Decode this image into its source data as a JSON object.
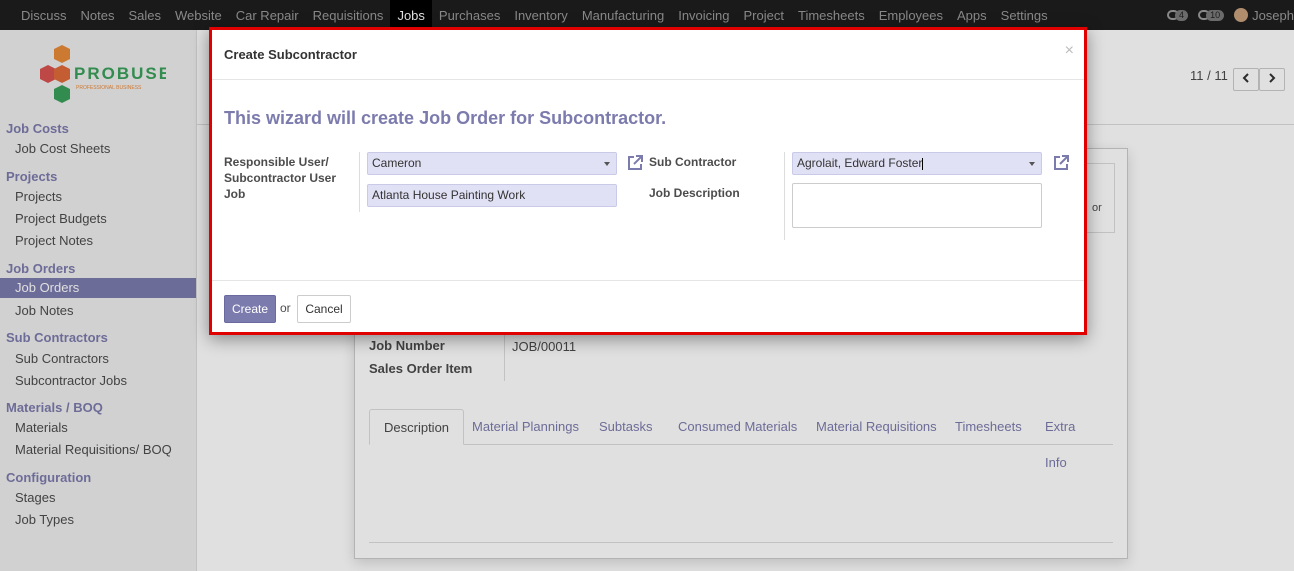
{
  "menu": [
    "Discuss",
    "Notes",
    "Sales",
    "Website",
    "Car Repair",
    "Requisitions",
    "Jobs",
    "Purchases",
    "Inventory",
    "Manufacturing",
    "Invoicing",
    "Project",
    "Timesheets",
    "Employees",
    "Apps",
    "Settings"
  ],
  "menu_active": "Jobs",
  "topbar": {
    "chat_count": "4",
    "activity_count": "10",
    "user": "Joseph"
  },
  "logo": {
    "name": "PROBUSE",
    "tagline": "PROFESSIONAL BUSINESS"
  },
  "sidebar": {
    "sections": [
      {
        "title": "Job Costs",
        "items": [
          "Job Cost Sheets"
        ]
      },
      {
        "title": "Projects",
        "items": [
          "Projects",
          "Project Budgets",
          "Project Notes"
        ]
      },
      {
        "title": "Job Orders",
        "items": [
          "Job Orders",
          "Job Notes"
        ]
      },
      {
        "title": "Sub Contractors",
        "items": [
          "Sub Contractors",
          "Subcontractor Jobs"
        ]
      },
      {
        "title": "Materials / BOQ",
        "items": [
          "Materials",
          "Material Requisitions/ BOQ"
        ]
      },
      {
        "title": "Configuration",
        "items": [
          "Stages",
          "Job Types"
        ]
      }
    ],
    "active_item": "Job Orders"
  },
  "pager": {
    "text": "11 / 11"
  },
  "background": {
    "job_number_label": "Job Number",
    "job_number_value": "JOB/00011",
    "sales_order_item_label": "Sales Order Item",
    "partial_text": "or",
    "tabs": [
      "Description",
      "Material Plannings",
      "Subtasks",
      "Consumed Materials",
      "Material Requisitions",
      "Timesheets",
      "Extra Info"
    ]
  },
  "modal": {
    "title": "Create Subcontractor",
    "close": "×",
    "intro": "This wizard will create Job Order for Subcontractor.",
    "responsible_label_1": "Responsible User/",
    "responsible_label_2": "Subcontractor User",
    "job_label": "Job",
    "responsible_value": "Cameron",
    "job_value": "Atlanta House Painting Work",
    "sub_contractor_label": "Sub Contractor",
    "sub_contractor_value": "Agrolait, Edward Foster",
    "job_description_label": "Job Description",
    "job_description_value": "",
    "create_button": "Create",
    "or_text": "or",
    "cancel_button": "Cancel"
  },
  "colors": {
    "brand": "#7c7bad",
    "highlight_border": "#e00000",
    "field_bg": "#e1e1f5"
  }
}
